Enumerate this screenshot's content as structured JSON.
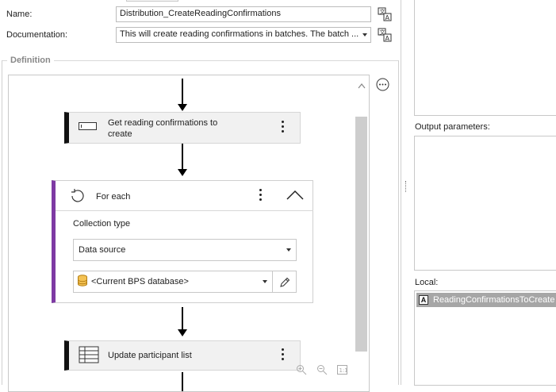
{
  "properties": {
    "name_label": "Name:",
    "name_value": "Distribution_CreateReadingConfirmations",
    "doc_label": "Documentation:",
    "doc_value": "This will create reading confirmations in batches. The batch ..."
  },
  "definition": {
    "group_label": "Definition",
    "steps": {
      "step1_label": "Get reading confirmations to create",
      "foreach_label": "For each",
      "collection_type_label": "Collection type",
      "collection_type_value": "Data source",
      "database_value": "<Current BPS database>",
      "step3_label": "Update participant list"
    }
  },
  "right_panel": {
    "output_params_label": "Output parameters:",
    "local_label": "Local:",
    "local_items": [
      "ReadingConfirmationsToCreate"
    ]
  },
  "colors": {
    "foreach_accent": "#7e3aa3",
    "step_accent": "#111111",
    "local_item_selected_bg": "#a6a6a6"
  }
}
